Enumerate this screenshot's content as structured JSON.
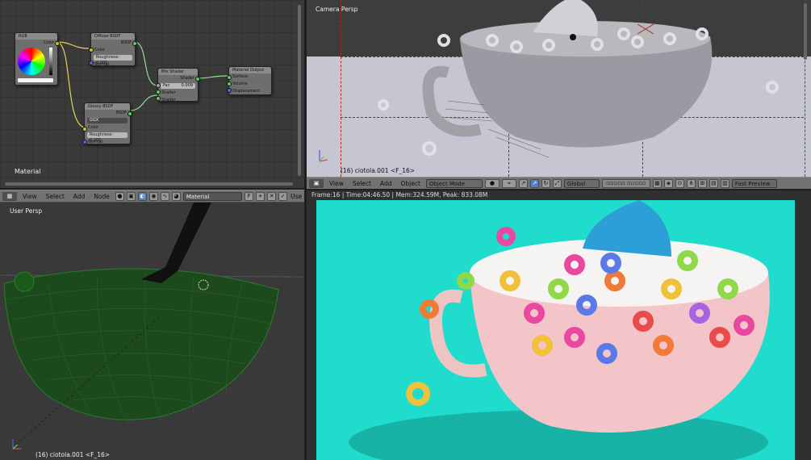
{
  "node_editor": {
    "nodes": {
      "rgb": {
        "title": "RGB",
        "out": "Color"
      },
      "diffuse": {
        "title": "Diffuse BSDF",
        "out": "BSDF",
        "in_color": "Color",
        "roughness": "Roughness: 0.000",
        "in_normal": "Normal"
      },
      "glossy": {
        "title": "Glossy BSDF",
        "out": "BSDF",
        "dist": "GGX",
        "in_color": "Color",
        "roughness": "Roughness: 0.200",
        "in_normal": "Normal"
      },
      "mix": {
        "title": "Mix Shader",
        "out": "Shader",
        "fac": "Fac",
        "fac_val": "0.009",
        "in1": "Shader",
        "in2": "Shader"
      },
      "output": {
        "title": "Material Output",
        "in1": "Surface",
        "in2": "Volume",
        "in3": "Displacement"
      }
    },
    "label": "Material",
    "header": {
      "menus": [
        "View",
        "Select",
        "Add",
        "Node"
      ],
      "material_name": "Material",
      "f_label": "F",
      "use_nodes": "Use Nodes"
    }
  },
  "camera_view": {
    "label": "Camera Persp",
    "object_label": "(16) ciotola.001 <F_16>",
    "header": {
      "menus": [
        "View",
        "Select",
        "Add",
        "Object"
      ],
      "mode": "Object Mode",
      "orientation": "Global",
      "preview": "Fast Preview"
    }
  },
  "render_view": {
    "info": "Frame:16 | Time:04:46.50 | Mem:324.59M, Peak: 833.08M"
  },
  "user_view": {
    "label": "User Persp",
    "object_label": "(16) ciotola.001 <F_16>"
  },
  "colors": {
    "render_bg": "#1fdccc",
    "bowl_outer": "#f3c4c8",
    "spoon": "#2b9fd6",
    "wire_green": "#1c4a1c"
  }
}
